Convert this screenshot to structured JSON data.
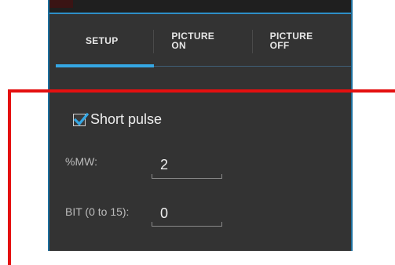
{
  "tabs": [
    {
      "label": "SETUP",
      "active": true
    },
    {
      "label": "PICTURE\nON",
      "active": false
    },
    {
      "label": "PICTURE\nOFF",
      "active": false
    }
  ],
  "short_pulse": {
    "label": "Short pulse",
    "checked": true
  },
  "fields": {
    "mw": {
      "label": "%MW:",
      "value": "2"
    },
    "bit": {
      "label": "BIT (0 to 15):",
      "value": "0"
    }
  },
  "colors": {
    "panel_bg": "#333333",
    "accent": "#35a7e4",
    "highlight_frame": "#e41010"
  }
}
